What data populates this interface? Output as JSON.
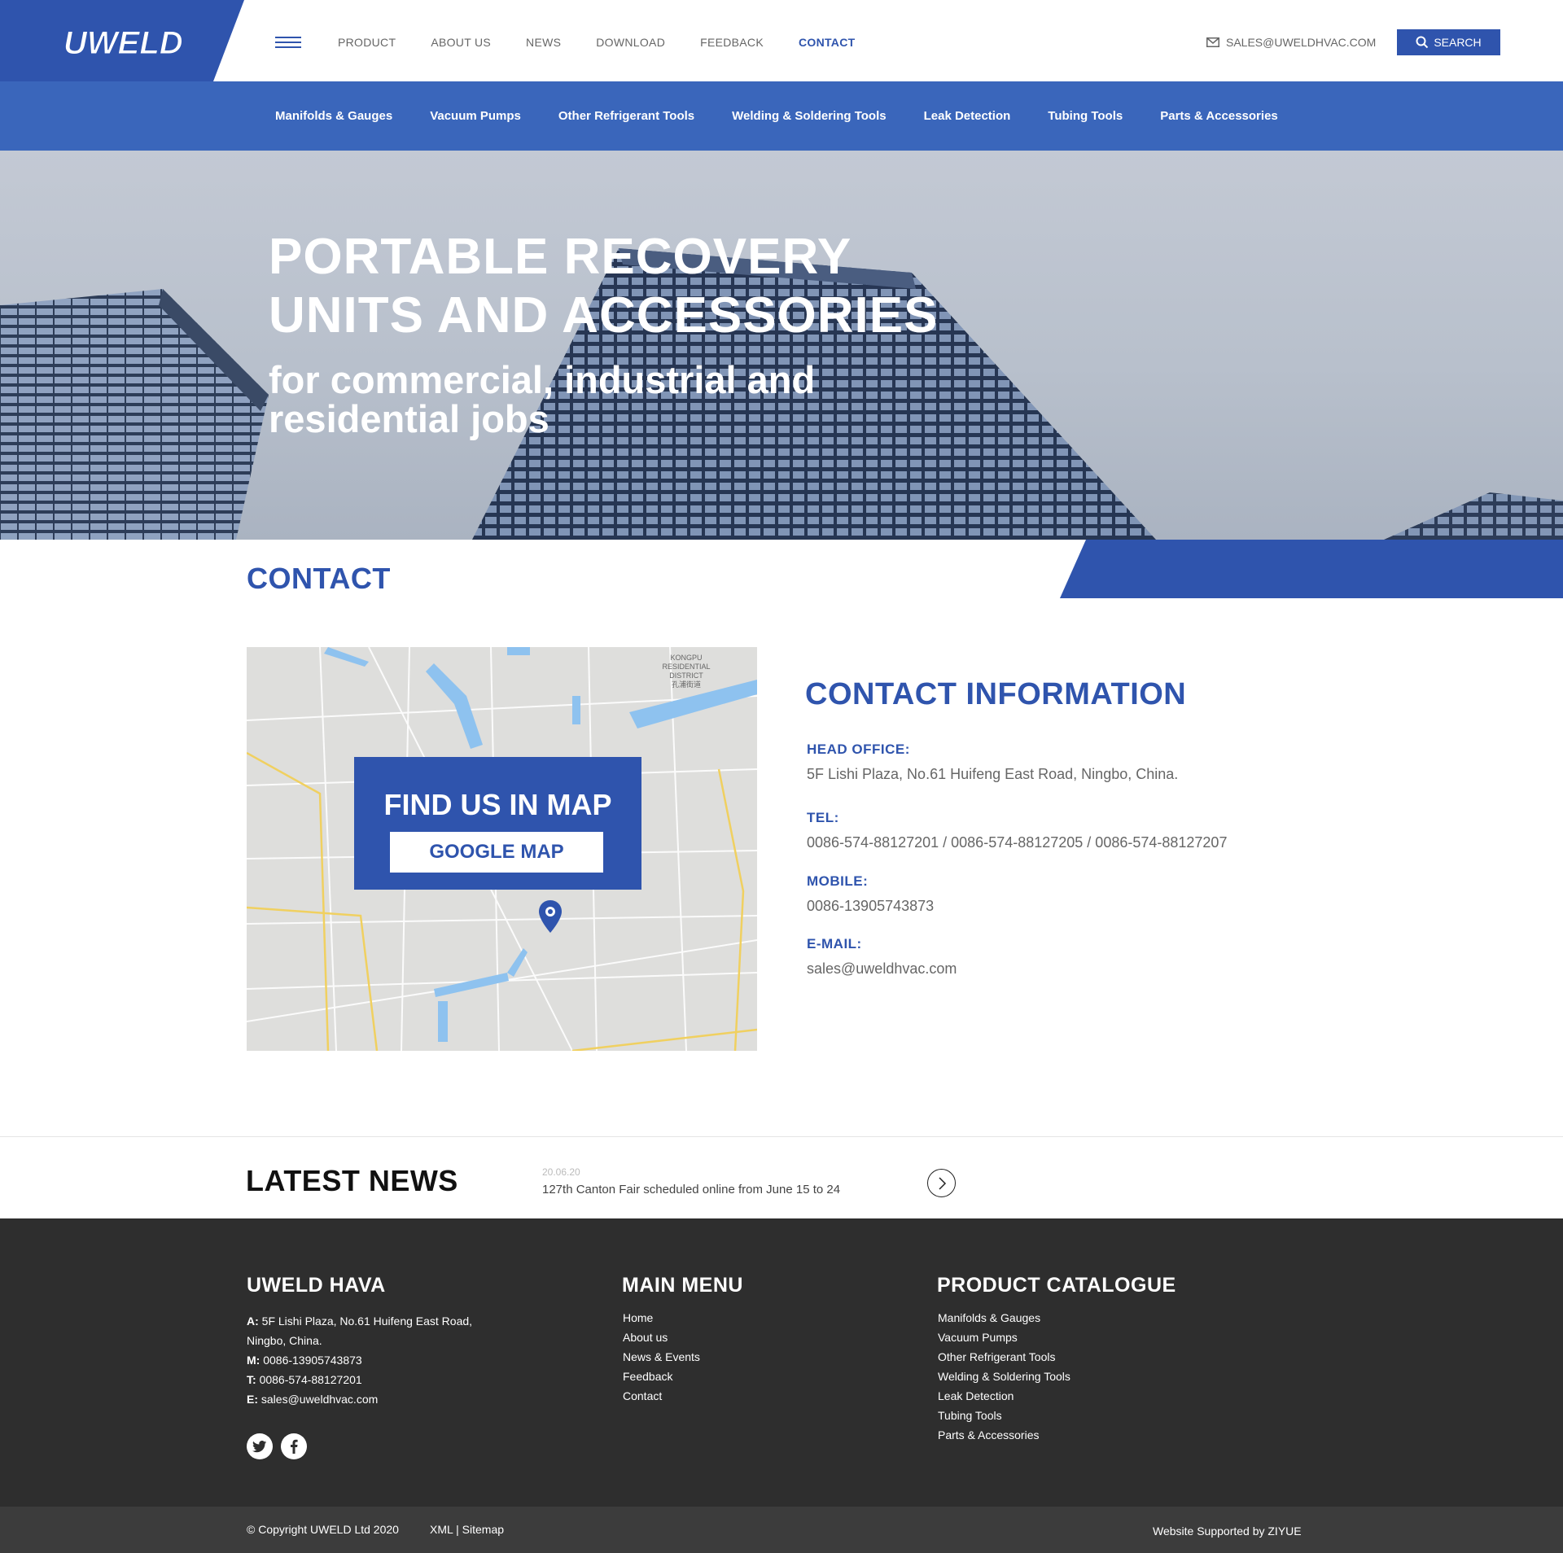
{
  "header": {
    "logo_text": "UWELD",
    "nav": [
      {
        "label": "PRODUCT",
        "active": false
      },
      {
        "label": "ABOUT US",
        "active": false
      },
      {
        "label": "NEWS",
        "active": false
      },
      {
        "label": "DOWNLOAD",
        "active": false
      },
      {
        "label": "FEEDBACK",
        "active": false
      },
      {
        "label": "CONTACT",
        "active": true
      }
    ],
    "email": "SALES@UWELDHVAC.COM",
    "search_label": "SEARCH"
  },
  "subnav": [
    "Manifolds & Gauges",
    "Vacuum Pumps",
    "Other Refrigerant Tools",
    "Welding & Soldering Tools",
    "Leak Detection",
    "Tubing Tools",
    "Parts & Accessories"
  ],
  "hero": {
    "title_line1": "PORTABLE RECOVERY",
    "title_line2": "UNITS AND ACCESSORIES",
    "sub_line1": "for commercial, industrial and",
    "sub_line2": "residential jobs"
  },
  "page_title": "CONTACT",
  "map": {
    "heading": "FIND US IN MAP",
    "button": "GOOGLE MAP",
    "district_line1": "KONGPU",
    "district_line2": "RESIDENTIAL",
    "district_line3": "DISTRICT",
    "district_line4": "孔浦街道"
  },
  "contact": {
    "title": "CONTACT INFORMATION",
    "head_office_label": "HEAD OFFICE:",
    "head_office": "5F Lishi Plaza, No.61 Huifeng East Road, Ningbo, China.",
    "tel_label": "TEL:",
    "tel": "0086-574-88127201 / 0086-574-88127205 / 0086-574-88127207",
    "mobile_label": "MOBILE:",
    "mobile": "0086-13905743873",
    "email_label": "E-MAIL:",
    "email": "sales@uweldhvac.com"
  },
  "news": {
    "title": "LATEST NEWS",
    "date": "20.06.20",
    "headline": "127th Canton Fair scheduled online from June 15 to 24"
  },
  "footer": {
    "company": {
      "heading": "UWELD HAVA",
      "addr_label": "A:",
      "addr_line1": "5F Lishi Plaza, No.61 Huifeng East Road,",
      "addr_line2": "Ningbo, China.",
      "mobile_label": "M:",
      "mobile": "0086-13905743873",
      "tel_label": "T:",
      "tel": "0086-574-88127201",
      "email_label": "E:",
      "email": "sales@uweldhvac.com"
    },
    "menu": {
      "heading": "MAIN MENU",
      "items": [
        "Home",
        "About us",
        "News & Events",
        "Feedback",
        "Contact"
      ]
    },
    "catalogue": {
      "heading": "PRODUCT CATALOGUE",
      "items": [
        "Manifolds & Gauges",
        "Vacuum Pumps",
        "Other Refrigerant Tools",
        "Welding & Soldering Tools",
        "Leak Detection",
        "Tubing Tools",
        "Parts & Accessories"
      ]
    },
    "social": [
      "twitter-icon",
      "facebook-icon"
    ]
  },
  "bottom": {
    "copyright": "© Copyright UWELD Ltd 2020",
    "links": "XML | Sitemap",
    "supported": "Website Supported by ZIYUE"
  },
  "colors": {
    "brand": "#2f54ad",
    "subnav": "#3a66bb",
    "footer": "#2e2e2e"
  }
}
